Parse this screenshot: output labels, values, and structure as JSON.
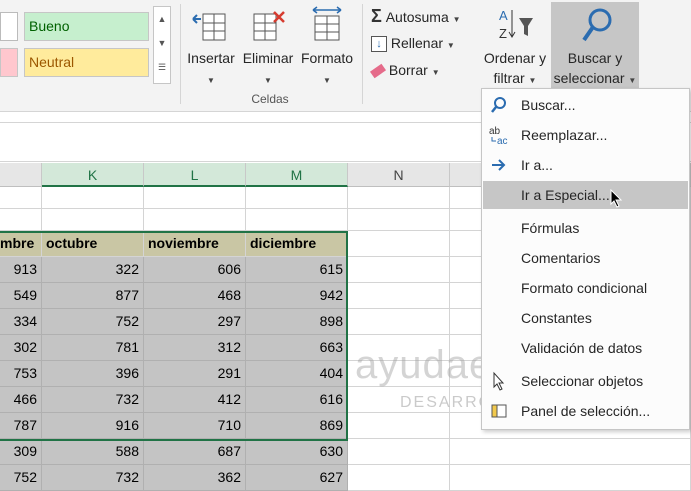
{
  "ribbon": {
    "styles": {
      "good": "Bueno",
      "neutral": "Neutral"
    },
    "cells_group": {
      "label": "Celdas",
      "insert": "Insertar",
      "delete": "Eliminar",
      "format": "Formato"
    },
    "editing": {
      "autosum": "Autosuma",
      "fill": "Rellenar",
      "clear": "Borrar",
      "sort_filter_line1": "Ordenar y",
      "sort_filter_line2": "filtrar",
      "find_select_line1": "Buscar y",
      "find_select_line2": "seleccionar"
    }
  },
  "columns": [
    "K",
    "L",
    "M",
    "N"
  ],
  "sheet": {
    "headers": [
      "mbre",
      "octubre",
      "noviembre",
      "diciembre"
    ],
    "rows": [
      [
        "913",
        "322",
        "606",
        "615"
      ],
      [
        "549",
        "877",
        "468",
        "942"
      ],
      [
        "334",
        "752",
        "297",
        "898"
      ],
      [
        "302",
        "781",
        "312",
        "663"
      ],
      [
        "753",
        "396",
        "291",
        "404"
      ],
      [
        "466",
        "732",
        "412",
        "616"
      ],
      [
        "787",
        "916",
        "710",
        "869"
      ],
      [
        "309",
        "588",
        "687",
        "630"
      ],
      [
        "752",
        "732",
        "362",
        "627"
      ]
    ]
  },
  "menu": {
    "items": [
      {
        "label": "Buscar...",
        "icon": "search-icon"
      },
      {
        "label": "Reemplazar...",
        "icon": "replace-icon"
      },
      {
        "label": "Ir a...",
        "icon": "arrow-right-icon"
      },
      {
        "label": "Ir a Especial...",
        "icon": ""
      },
      {
        "label": "Fórmulas",
        "icon": ""
      },
      {
        "label": "Comentarios",
        "icon": ""
      },
      {
        "label": "Formato condicional",
        "icon": ""
      },
      {
        "label": "Constantes",
        "icon": ""
      },
      {
        "label": "Validación de datos",
        "icon": ""
      },
      {
        "label": "Seleccionar objetos",
        "icon": "pointer-icon"
      },
      {
        "label": "Panel de selección...",
        "icon": "selection-pane-icon"
      }
    ]
  },
  "watermark": {
    "brand": "ayudaexcel",
    "tagline": "DESARROLLO Y FORMACIÓN"
  },
  "colors": {
    "accent": "#217346",
    "good_fill": "#c6efce",
    "neutral_fill": "#ffeb9c",
    "header_fill": "#c9c6a4",
    "selection_fill": "#c4c4c4"
  }
}
